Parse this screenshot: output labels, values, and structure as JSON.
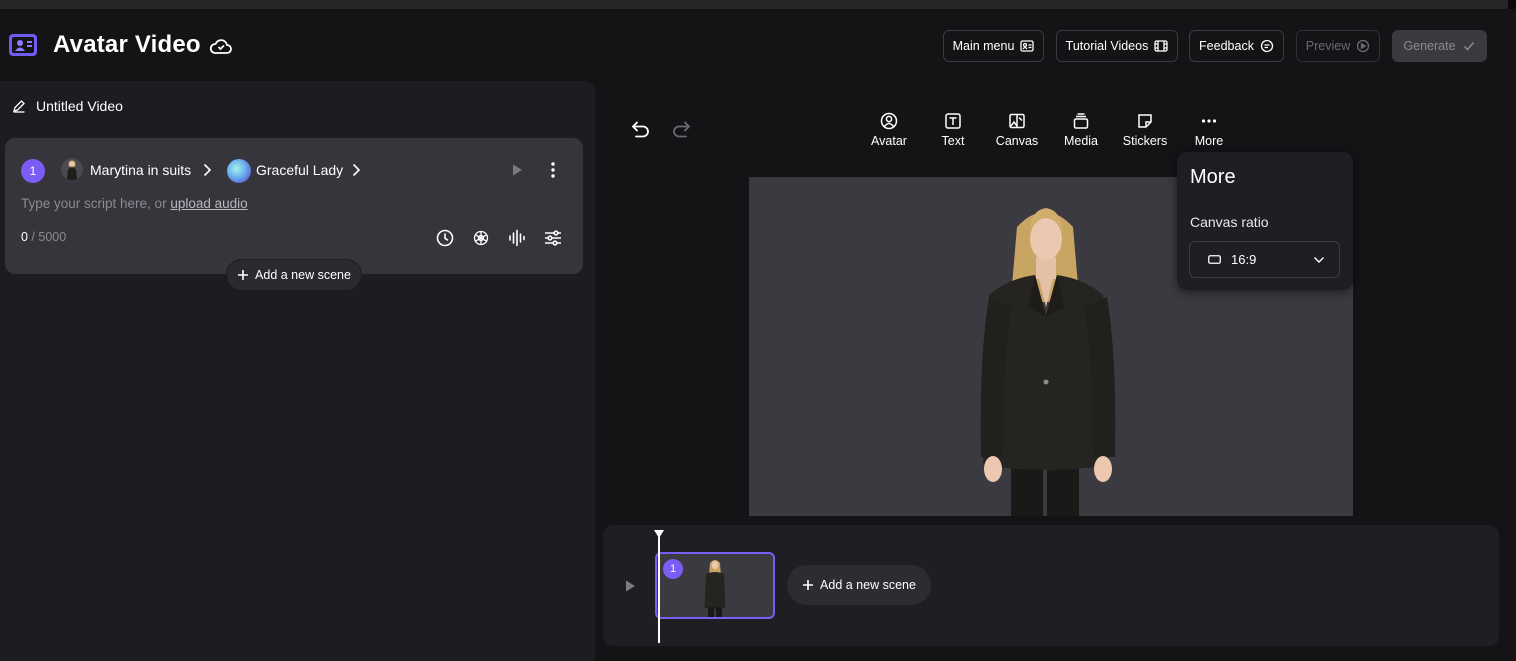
{
  "colors": {
    "accent": "#7b5cf5",
    "background": "#141417",
    "panel": "#1d1d21",
    "card": "#35353b",
    "canvas_bg": "#3a3a40"
  },
  "header": {
    "app_title": "Avatar Video",
    "buttons": {
      "main_menu": "Main menu",
      "tutorial_videos": "Tutorial Videos",
      "feedback": "Feedback",
      "preview": "Preview",
      "generate": "Generate"
    }
  },
  "editor": {
    "project_title": "Untitled Video",
    "scene": {
      "number": "1",
      "avatar_name": "Marytina in suits",
      "voice_name": "Graceful Lady",
      "script_placeholder": "Type your script here, or ",
      "upload_audio_link": "upload audio",
      "char_count": "0",
      "char_max": " / 5000"
    },
    "add_scene_label": "Add a new scene"
  },
  "toolbar": {
    "avatar": "Avatar",
    "text": "Text",
    "canvas": "Canvas",
    "media": "Media",
    "stickers": "Stickers",
    "more": "More"
  },
  "more_popup": {
    "title": "More",
    "canvas_ratio_label": "Canvas ratio",
    "canvas_ratio_value": "16:9"
  },
  "timeline": {
    "scene_number": "1",
    "add_scene_label": "Add a new scene"
  }
}
